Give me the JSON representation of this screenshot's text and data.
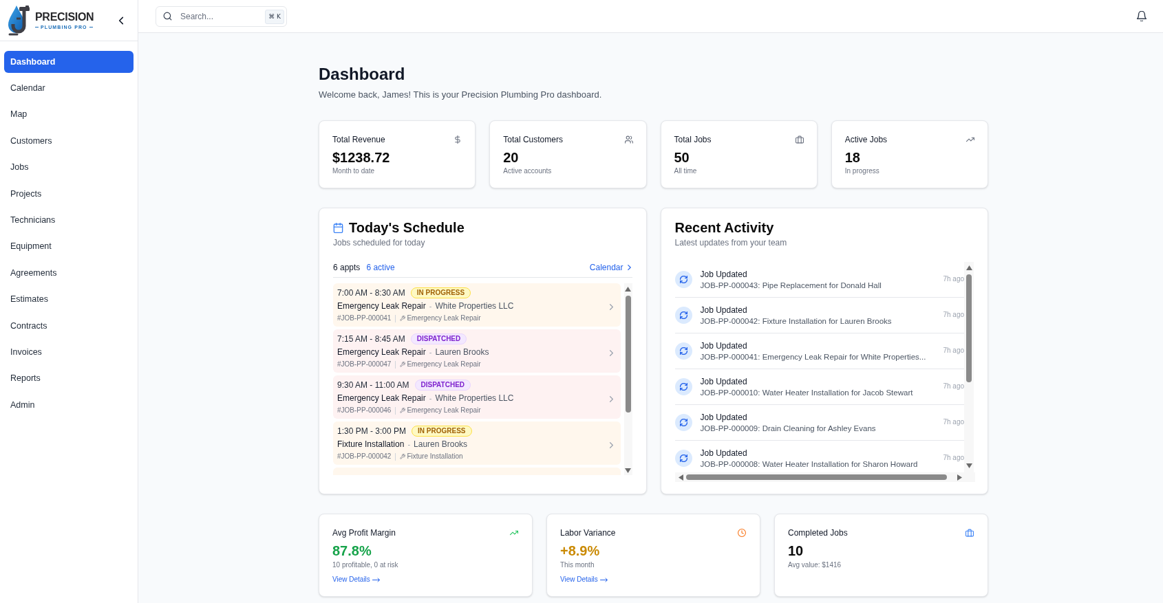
{
  "sidebar": {
    "logo": {
      "name": "PRECISION",
      "tagline": "PLUMBING PRO"
    },
    "items": [
      {
        "label": "Dashboard",
        "selected": true
      },
      {
        "label": "Calendar",
        "selected": false
      },
      {
        "label": "Map",
        "selected": false
      },
      {
        "label": "Customers",
        "selected": false
      },
      {
        "label": "Jobs",
        "selected": false
      },
      {
        "label": "Projects",
        "selected": false
      },
      {
        "label": "Technicians",
        "selected": false
      },
      {
        "label": "Equipment",
        "selected": false
      },
      {
        "label": "Agreements",
        "selected": false
      },
      {
        "label": "Estimates",
        "selected": false
      },
      {
        "label": "Contracts",
        "selected": false
      },
      {
        "label": "Invoices",
        "selected": false
      },
      {
        "label": "Reports",
        "selected": false
      },
      {
        "label": "Admin",
        "selected": false
      }
    ]
  },
  "topbar": {
    "search": {
      "placeholder": "Search...",
      "shortcut": "⌘ K"
    }
  },
  "page": {
    "title": "Dashboard",
    "subtitle": "Welcome back, James! This is your Precision Plumbing Pro dashboard."
  },
  "stats": [
    {
      "kind": "revenue",
      "label": "Total Revenue",
      "value": "$1238.72",
      "caption": "Month to date"
    },
    {
      "kind": "customers",
      "label": "Total Customers",
      "value": "20",
      "caption": "Active accounts"
    },
    {
      "kind": "jobs",
      "label": "Total Jobs",
      "value": "50",
      "caption": "All time"
    },
    {
      "kind": "active",
      "label": "Active Jobs",
      "value": "18",
      "caption": "In progress"
    }
  ],
  "schedule": {
    "title": "Today's Schedule",
    "subtitle": "Jobs scheduled for today",
    "count": "6 appts",
    "active": "6 active",
    "link": "Calendar",
    "items": [
      {
        "kind": "progress",
        "time": "7:00 AM - 8:30 AM",
        "status": "IN PROGRESS",
        "job": "Emergency Leak Repair",
        "separator": "-",
        "customer": "White Properties LLC",
        "number": "#JOB-PP-000041",
        "service": "Emergency Leak Repair"
      },
      {
        "kind": "dispatched",
        "time": "7:15 AM - 8:45 AM",
        "status": "DISPATCHED",
        "job": "Emergency Leak Repair",
        "separator": "-",
        "customer": "Lauren Brooks",
        "number": "#JOB-PP-000047",
        "service": "Emergency Leak Repair"
      },
      {
        "kind": "dispatched",
        "time": "9:30 AM - 11:00 AM",
        "status": "DISPATCHED",
        "job": "Emergency Leak Repair",
        "separator": "-",
        "customer": "White Properties LLC",
        "number": "#JOB-PP-000046",
        "service": "Emergency Leak Repair"
      },
      {
        "kind": "progress",
        "time": "1:30 PM - 3:00 PM",
        "status": "IN PROGRESS",
        "job": "Fixture Installation",
        "separator": "-",
        "customer": "Lauren Brooks",
        "number": "#JOB-PP-000042",
        "service": "Fixture Installation"
      },
      {
        "kind": "progress"
      }
    ]
  },
  "activity": {
    "title": "Recent Activity",
    "subtitle": "Latest updates from your team",
    "items": [
      {
        "title": "Job Updated",
        "detail": "JOB-PP-000043: Pipe Replacement for Donald Hall",
        "time": "7h ago"
      },
      {
        "title": "Job Updated",
        "detail": "JOB-PP-000042: Fixture Installation for Lauren Brooks",
        "time": "7h ago"
      },
      {
        "title": "Job Updated",
        "detail": "JOB-PP-000041: Emergency Leak Repair for White Properties...",
        "time": "7h ago"
      },
      {
        "title": "Job Updated",
        "detail": "JOB-PP-000010: Water Heater Installation for Jacob Stewart",
        "time": "7h ago"
      },
      {
        "title": "Job Updated",
        "detail": "JOB-PP-000009: Drain Cleaning for Ashley Evans",
        "time": "7h ago"
      },
      {
        "title": "Job Updated",
        "detail": "JOB-PP-000008: Water Heater Installation for Sharon Howard",
        "time": "7h ago"
      }
    ]
  },
  "metrics": [
    {
      "kind": "profit",
      "label": "Avg Profit Margin",
      "value": "87.8%",
      "caption": "10 profitable, 0 at risk",
      "link": "View Details"
    },
    {
      "kind": "labor",
      "label": "Labor Variance",
      "value": "+8.9%",
      "caption": "This month",
      "link": "View Details"
    },
    {
      "kind": "completed",
      "label": "Completed Jobs",
      "value": "10",
      "caption": "Avg value: $1416"
    }
  ]
}
